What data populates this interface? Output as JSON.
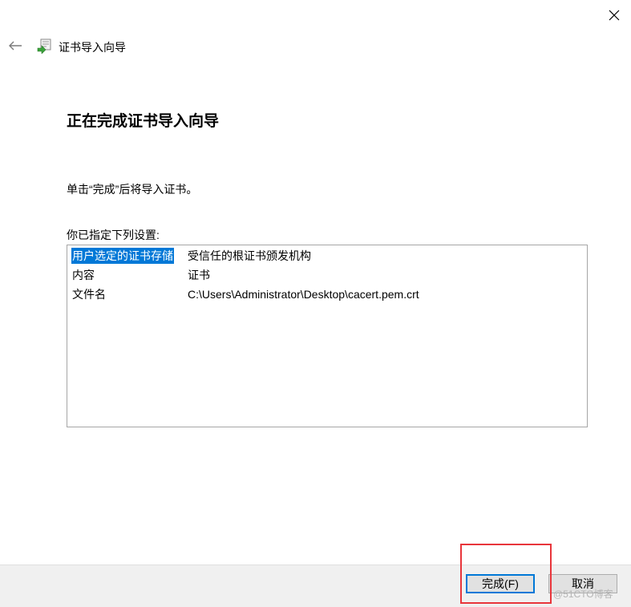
{
  "window": {
    "title": "证书导入向导",
    "close_icon": "close-icon",
    "back_icon": "back-arrow-icon",
    "wizard_icon": "certificate-wizard-icon"
  },
  "main": {
    "heading": "正在完成证书导入向导",
    "instruction": "单击“完成”后将导入证书。",
    "settings_label": "你已指定下列设置:",
    "settings": [
      {
        "key": "用户选定的证书存储",
        "value": "受信任的根证书颁发机构"
      },
      {
        "key": "内容",
        "value": "证书"
      },
      {
        "key": "文件名",
        "value": "C:\\Users\\Administrator\\Desktop\\cacert.pem.crt"
      }
    ]
  },
  "footer": {
    "finish_label": "完成(F)",
    "cancel_label": "取消"
  },
  "watermark": "@51CTO博客",
  "colors": {
    "selection": "#0078d7",
    "highlight_border": "#e8353b",
    "footer_bg": "#f0f0f0"
  }
}
